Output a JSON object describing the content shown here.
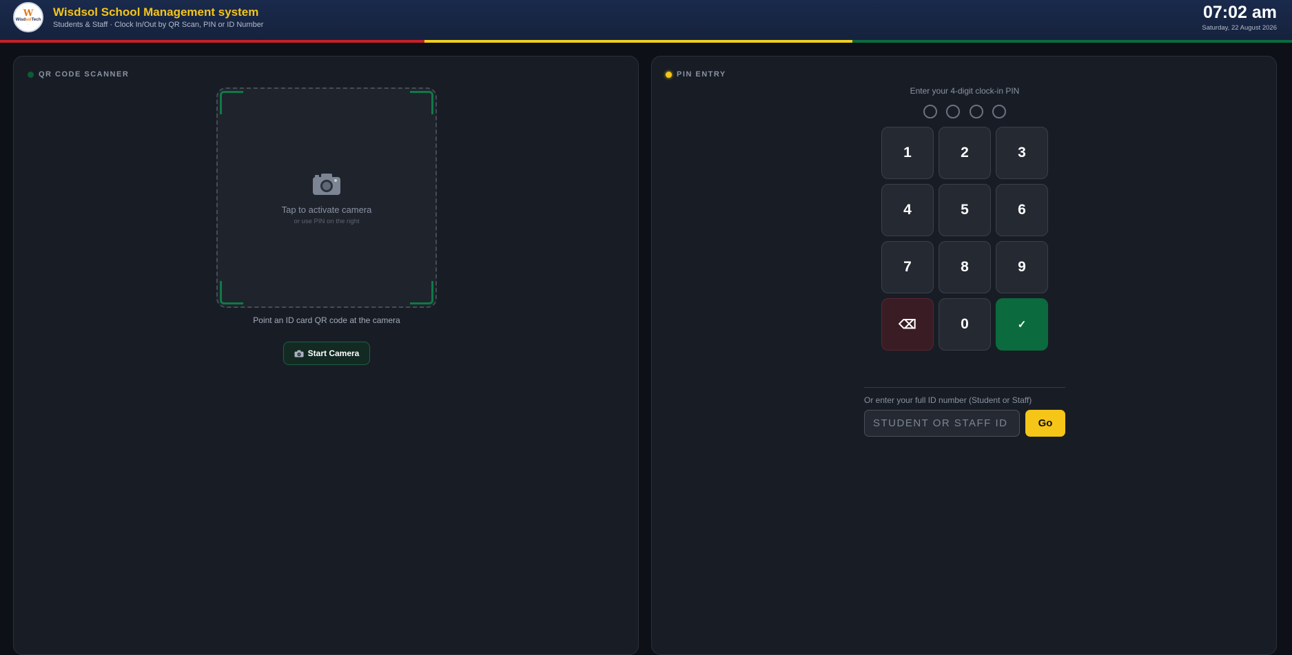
{
  "header": {
    "logo": {
      "mark": "W",
      "word_left": "Wisd",
      "word_mid": "sol",
      "word_right": "Tech",
      "tagline": "...."
    },
    "title": "Wisdsol School Management system",
    "subtitle": "Students & Staff · Clock In/Out by QR Scan, PIN or ID Number",
    "time": "07:02 am",
    "date": "Saturday, 22 August 2026"
  },
  "stripes": {
    "red": "#c8202a",
    "yellow": "#f2cf1f",
    "green": "#0b6b3e"
  },
  "scanner_panel": {
    "heading": "QR CODE SCANNER",
    "camera_icon": "camera-icon",
    "activate_text": "Tap to activate camera",
    "activate_subtext": "or use PIN on the right",
    "hint": "Point an ID card QR code at the camera",
    "start_button": {
      "icon": "camera-icon",
      "label": "Start Camera"
    }
  },
  "pin_panel": {
    "heading": "PIN ENTRY",
    "prompt": "Enter your 4-digit clock-in PIN",
    "pin_length": 4,
    "keys": [
      "1",
      "2",
      "3",
      "4",
      "5",
      "6",
      "7",
      "8",
      "9",
      "⌫",
      "0",
      "✓"
    ],
    "id_label": "Or enter your full ID number (Student or Staff)",
    "id_input": {
      "value": "",
      "placeholder": "Student or Staff ID"
    },
    "go_label": "Go"
  },
  "colors": {
    "accent": "#f5c518",
    "success": "#0b6b3e",
    "danger": "#3a1c24",
    "background": "#0d1117",
    "panel": "#181d25"
  }
}
